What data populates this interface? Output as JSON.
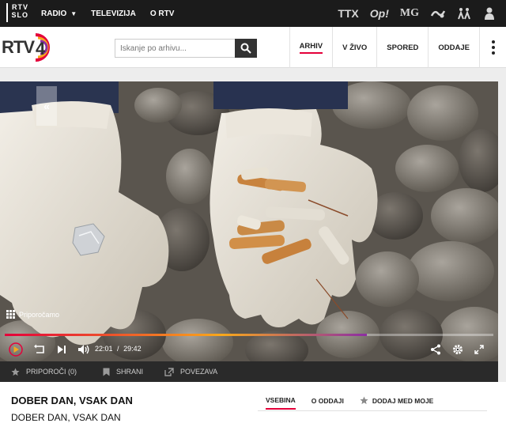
{
  "topbar": {
    "logo_line1": "RTV",
    "logo_line2": "SLO",
    "nav": [
      {
        "label": "RADIO",
        "has_dropdown": true
      },
      {
        "label": "TELEVIZIJA"
      },
      {
        "label": "O RTV"
      }
    ],
    "icons": [
      {
        "name": "ttx-icon",
        "label": "TTX"
      },
      {
        "name": "ognjisce-icon",
        "label": "Op!"
      },
      {
        "name": "mg-icon",
        "label": "MG"
      },
      {
        "name": "sport-icon",
        "label": "ꝏ"
      },
      {
        "name": "accessibility-icon",
        "label": "♿"
      },
      {
        "name": "user-icon",
        "label": ""
      }
    ]
  },
  "header": {
    "logo_text": "RTV",
    "logo_number": "4",
    "search_placeholder": "Iskanje po arhivu...",
    "nav": [
      {
        "label": "ARHIV",
        "active": true
      },
      {
        "label": "V ŽIVO"
      },
      {
        "label": "SPORED"
      },
      {
        "label": "ODDAJE"
      }
    ]
  },
  "player": {
    "recommend_label": "Priporočamo",
    "current_time": "22:01",
    "time_separator": "/",
    "duration": "29:42",
    "progress": 0.741
  },
  "actions": {
    "recommend_label": "PRIPOROČI (0)",
    "save_label": "SHRANI",
    "link_label": "POVEZAVA"
  },
  "show": {
    "title": "DOBER DAN, VSAK DAN",
    "subtitle": "DOBER DAN, VSAK DAN",
    "tabs": [
      {
        "label": "VSEBINA",
        "active": true
      },
      {
        "label": "O ODDAJI"
      },
      {
        "label": "DODAJ MED MOJE"
      }
    ]
  },
  "colors": {
    "accent": "#e4003a",
    "topbar_bg": "#1b1b1b",
    "action_bg": "#2a2a2a"
  }
}
